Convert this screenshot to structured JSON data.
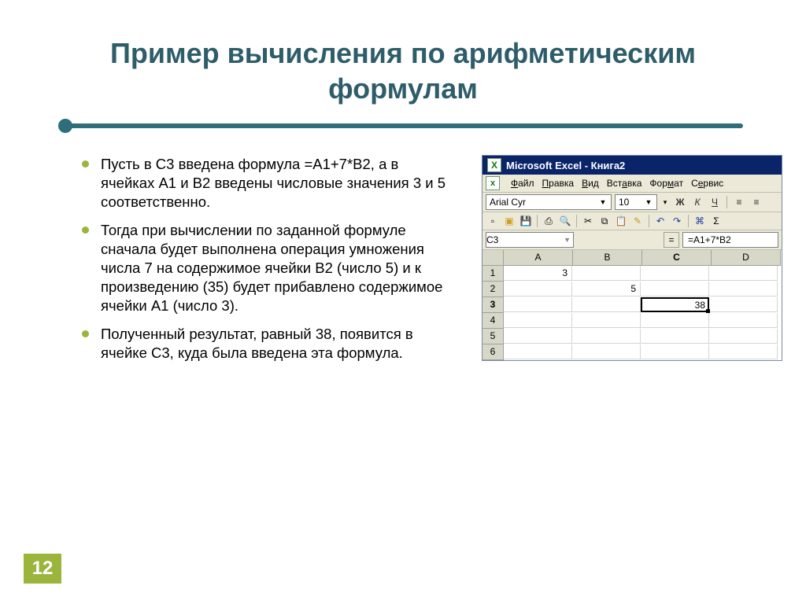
{
  "title": "Пример вычисления по арифметическим формулам",
  "bullets": [
    "Пусть в С3 введена формула =А1+7*В2, а в ячейках А1 и В2 введены числовые значения 3 и 5 соответственно.",
    "Тогда при вычислении по заданной формуле сначала будет выполнена операция умножения числа 7 на содержимое ячейки В2 (число 5) и к произведению (35) будет прибавлено содержимое ячейки А1 (число 3).",
    "Полученный результат, равный 38, появится в ячейке С3, куда была введена эта формула."
  ],
  "excel": {
    "title": "Microsoft Excel - Книга2",
    "menu": [
      "Файл",
      "Правка",
      "Вид",
      "Вставка",
      "Формат",
      "Сервис"
    ],
    "font": "Arial Cyr",
    "fontsize": "10",
    "bold": "Ж",
    "italic": "К",
    "underline": "Ч",
    "namebox": "C3",
    "formula": "=A1+7*B2",
    "cols": [
      "A",
      "B",
      "C",
      "D"
    ],
    "rows": [
      "1",
      "2",
      "3",
      "4",
      "5",
      "6"
    ],
    "cells": {
      "a1": "3",
      "b2": "5",
      "c3": "38"
    },
    "active_col": "C",
    "active_row": "3"
  },
  "page": "12"
}
